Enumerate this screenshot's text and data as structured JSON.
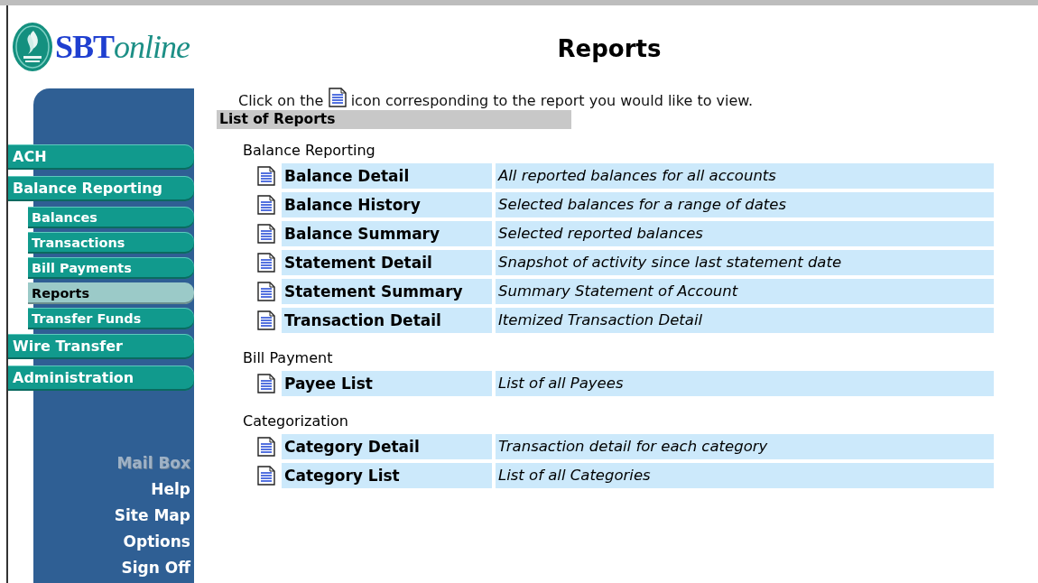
{
  "logo": {
    "brand": "SBT",
    "suffix": "online"
  },
  "sidebar": {
    "nav": [
      {
        "label": "ACH",
        "selected": false
      },
      {
        "label": "Balance Reporting",
        "selected": false,
        "children": [
          {
            "label": "Balances",
            "selected": false
          },
          {
            "label": "Transactions",
            "selected": false
          },
          {
            "label": "Bill Payments",
            "selected": false
          },
          {
            "label": "Reports",
            "selected": true
          },
          {
            "label": "Transfer Funds",
            "selected": false
          }
        ]
      },
      {
        "label": "Wire Transfer",
        "selected": false
      },
      {
        "label": "Administration",
        "selected": false
      }
    ],
    "links": [
      {
        "label": "Mail Box",
        "disabled": true
      },
      {
        "label": "Help",
        "disabled": false
      },
      {
        "label": "Site Map",
        "disabled": false
      },
      {
        "label": "Options",
        "disabled": false
      },
      {
        "label": "Sign Off",
        "disabled": false
      }
    ]
  },
  "page_title": "Reports",
  "instructions": {
    "before_icon": "Click on the",
    "after_icon": "icon corresponding to the report you would like to view."
  },
  "list_header": "List of Reports",
  "groups": [
    {
      "title": "Balance Reporting",
      "reports": [
        {
          "name": "Balance Detail",
          "description": "All reported balances for all accounts"
        },
        {
          "name": "Balance History",
          "description": "Selected balances for a range of dates"
        },
        {
          "name": "Balance Summary",
          "description": "Selected reported balances"
        },
        {
          "name": "Statement Detail",
          "description": "Snapshot of activity since last statement date"
        },
        {
          "name": "Statement Summary",
          "description": "Summary Statement of Account"
        },
        {
          "name": "Transaction Detail",
          "description": "Itemized Transaction Detail"
        }
      ]
    },
    {
      "title": "Bill Payment",
      "reports": [
        {
          "name": "Payee List",
          "description": "List of all Payees"
        }
      ]
    },
    {
      "title": "Categorization",
      "reports": [
        {
          "name": "Category Detail",
          "description": "Transaction detail for each category"
        },
        {
          "name": "Category List",
          "description": "List of all Categories"
        }
      ]
    }
  ]
}
